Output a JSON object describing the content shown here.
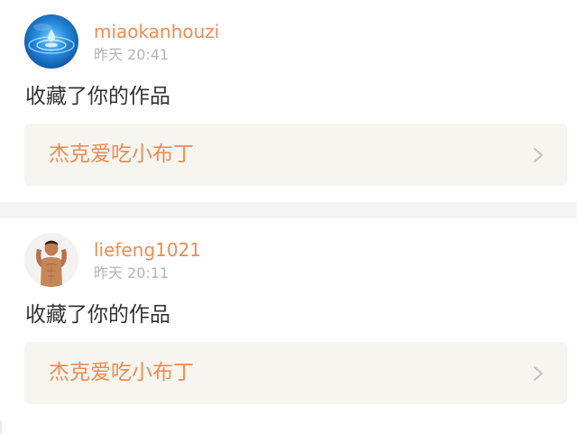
{
  "notifications": [
    {
      "username": "miaokanhouzi",
      "timestamp": "昨天 20:41",
      "action": "收藏了你的作品",
      "work_title": "杰克爱吃小布丁",
      "avatar_icon": "water-drop-avatar"
    },
    {
      "username": "liefeng1021",
      "timestamp": "昨天 20:11",
      "action": "收藏了你的作品",
      "work_title": "杰克爱吃小布丁",
      "avatar_icon": "person-photo-avatar"
    }
  ],
  "colors": {
    "accent": "#ef8b52",
    "muted": "#b5b5b5",
    "text": "#333333",
    "link_background": "#f7f5ef",
    "separator": "#f5f5f5"
  }
}
